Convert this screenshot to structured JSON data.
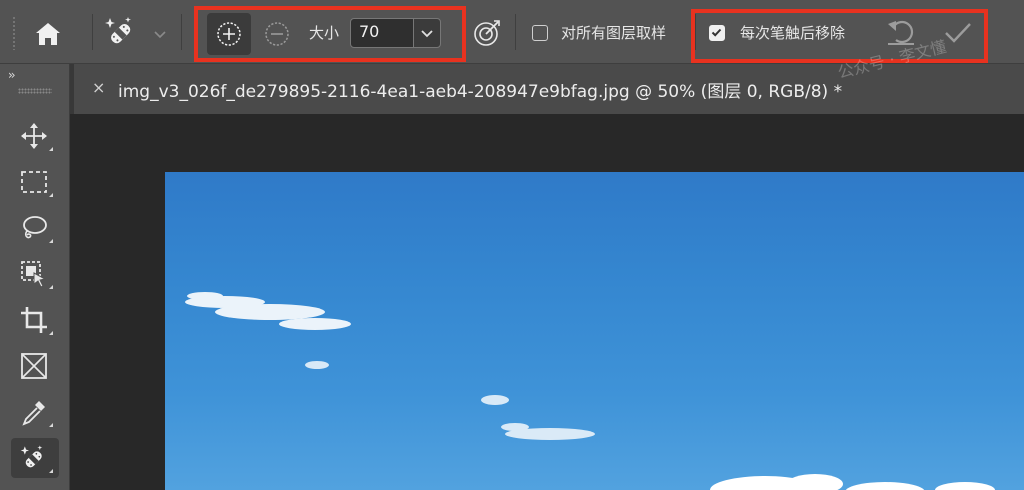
{
  "options_bar": {
    "home_icon": "home-icon",
    "tool_preset_icon": "spot-healing-brush-icon",
    "mode_add_icon": "circle-plus-icon",
    "mode_subtract_icon": "circle-minus-icon",
    "size_label": "大小",
    "size_value": "70",
    "target_icon": "target-icon",
    "sample_all_layers_label": "对所有图层取样",
    "sample_all_layers_checked": false,
    "remove_after_stroke_label": "每次笔触后移除",
    "remove_after_stroke_checked": true,
    "undo_icon": "undo-icon",
    "commit_icon": "checkmark-icon"
  },
  "toolbar": {
    "collapse_label": "››",
    "tools": [
      {
        "name": "move-tool",
        "icon": "move-icon"
      },
      {
        "name": "marquee-tool",
        "icon": "rect-marquee-icon"
      },
      {
        "name": "lasso-tool",
        "icon": "lasso-icon"
      },
      {
        "name": "object-select-tool",
        "icon": "object-select-icon"
      },
      {
        "name": "crop-tool",
        "icon": "crop-icon"
      },
      {
        "name": "frame-tool",
        "icon": "frame-icon"
      },
      {
        "name": "eyedropper-tool",
        "icon": "eyedropper-icon"
      },
      {
        "name": "spot-healing-tool",
        "icon": "spot-healing-brush-icon",
        "selected": true
      }
    ]
  },
  "document_tab": {
    "close_label": "×",
    "title": "img_v3_026f_de279895-2116-4ea1-aeb4-208947e9bfag.jpg @ 50% (图层 0, RGB/8) *"
  },
  "watermark": "公众号 · 李文懂",
  "colors": {
    "accent_highlight": "#e8321f",
    "sky_top": "#2f7ac8",
    "sky_bottom": "#52a2df"
  }
}
